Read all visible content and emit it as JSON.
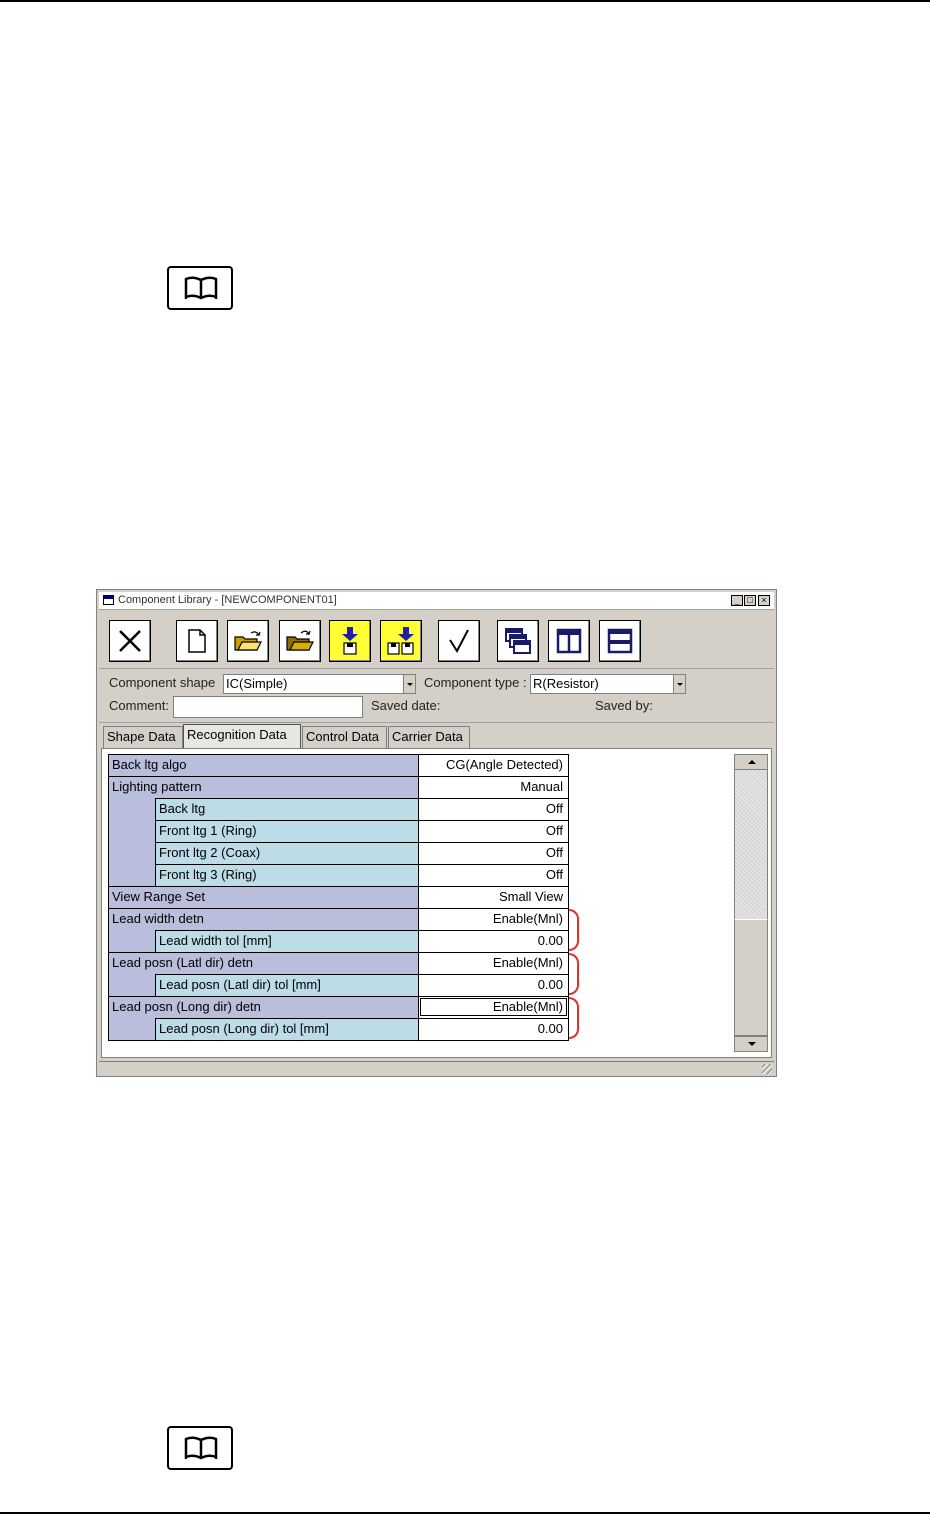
{
  "window": {
    "title": "Component Library - [NEWCOMPONENT01]",
    "minimize": "_",
    "maximize": "□",
    "close": "×"
  },
  "toolbar": {
    "tools": [
      "close-tool-icon",
      "new-file-icon",
      "open-folder-icon",
      "open-folder-alt-icon",
      "save-icon",
      "save-all-icon",
      "check-icon",
      "cascade-windows-icon",
      "tile-vertical-icon",
      "tile-horizontal-icon"
    ]
  },
  "form": {
    "shape_label": "Component shape",
    "shape_value": "IC(Simple)",
    "type_label": "Component type :",
    "type_value": "R(Resistor)",
    "comment_label": "Comment:",
    "comment_value": "",
    "saved_date_label": "Saved date:",
    "saved_by_label": "Saved by:"
  },
  "tabs": [
    "Shape Data",
    "Recognition Data",
    "Control Data",
    "Carrier Data"
  ],
  "active_tab": "Recognition Data",
  "grid": {
    "rows": [
      {
        "name": "Back ltg algo",
        "value": "CG(Angle Detected)"
      },
      {
        "name": "Lighting pattern",
        "value": "Manual"
      },
      {
        "name": "Back ltg",
        "value": "Off"
      },
      {
        "name": "Front ltg 1 (Ring)",
        "value": "Off"
      },
      {
        "name": "Front ltg 2 (Coax)",
        "value": "Off"
      },
      {
        "name": "Front ltg 3 (Ring)",
        "value": "Off"
      },
      {
        "name": "View Range Set",
        "value": "Small View"
      },
      {
        "name": "Lead width detn",
        "value": "Enable(Mnl)"
      },
      {
        "name": "Lead width tol [mm]",
        "value": "0.00"
      },
      {
        "name": "Lead posn (Latl dir) detn",
        "value": "Enable(Mnl)"
      },
      {
        "name": "Lead posn (Latl dir) tol [mm]",
        "value": "0.00"
      },
      {
        "name": "Lead posn (Long dir) detn",
        "value": "Enable(Mnl)"
      },
      {
        "name": "Lead posn (Long dir) tol [mm]",
        "value": "0.00"
      }
    ]
  },
  "colors": {
    "row_parent": "#b8bedc",
    "row_child": "#bcdce8",
    "highlight_bracket": "#e0302a",
    "tool_yellow": "#ffff33"
  }
}
